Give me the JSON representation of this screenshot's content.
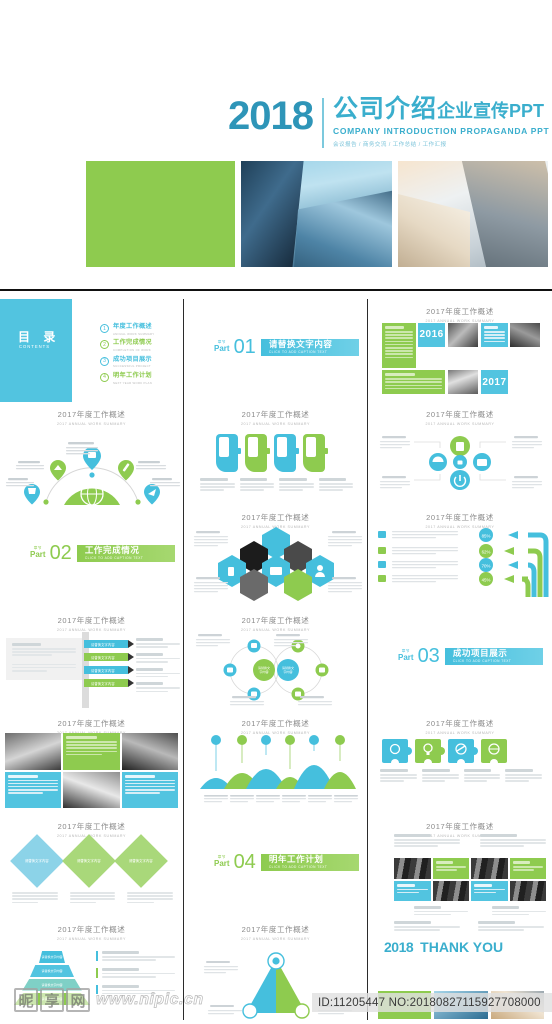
{
  "hero": {
    "year": "2018",
    "title_cn_strong": "公司介绍",
    "title_cn_light": "企业宣传PPT",
    "title_en": "COMPANY  INTRODUCTION   PROPAGANDA  PPT",
    "subtitle": "会议报告 / 商务交流 / 工作总结 / 工作汇报",
    "strip": [
      {
        "name": "green-block",
        "kind": "color",
        "color": "#8ecb4f"
      },
      {
        "name": "glass-towers-photo",
        "kind": "photo"
      },
      {
        "name": "sunlit-towers-photo",
        "kind": "photo"
      }
    ]
  },
  "colors": {
    "blue": "#45bfdd",
    "blue_panel": "#52c4e0",
    "blue_dark": "#2e95b8",
    "green": "#8ecb4f",
    "title_gray": "#8a8a8a"
  },
  "slide_title": {
    "cn": "2017年度工作概述",
    "en": "2017 ANNUAL WORK SUMMARY"
  },
  "contents": {
    "heading_cn": "目 录",
    "heading_en": "CONTENTS",
    "items": [
      {
        "num": "1",
        "cn": "年度工作概述",
        "en": "ANNUAL WORK SUMMARY",
        "color": "blue"
      },
      {
        "num": "2",
        "cn": "工作完成情况",
        "en": "COMPLETION OF WORK",
        "color": "green"
      },
      {
        "num": "3",
        "cn": "成功项目展示",
        "en": "SUCCESSFUL PROJECT",
        "color": "blue"
      },
      {
        "num": "4",
        "cn": "明年工作计划",
        "en": "NEXT YEAR WORK PLAN",
        "color": "green"
      }
    ]
  },
  "sections": [
    {
      "kicker_cn": "章节",
      "kicker_en": "Part",
      "num": "01",
      "cn": "请替换文字内容",
      "en": "CLICK TO ADD CAPTION TEXT",
      "theme": "blue"
    },
    {
      "kicker_cn": "章节",
      "kicker_en": "Part",
      "num": "02",
      "cn": "工作完成情况",
      "en": "CLICK TO ADD CAPTION TEXT",
      "theme": "green"
    },
    {
      "kicker_cn": "章节",
      "kicker_en": "Part",
      "num": "03",
      "cn": "成功项目展示",
      "en": "CLICK TO ADD CAPTION TEXT",
      "theme": "blue"
    },
    {
      "kicker_cn": "章节",
      "kicker_en": "Part",
      "num": "04",
      "cn": "明年工作计划",
      "en": "CLICK TO ADD CAPTION TEXT",
      "theme": "green"
    }
  ],
  "mosaic": {
    "year_left": "2016",
    "year_right": "2017"
  },
  "thank_you": {
    "year": "2018",
    "text": "THANK YOU"
  },
  "watermark": {
    "logo_chars": [
      "昵",
      "享",
      "网"
    ],
    "url": "www.nipic.cn",
    "id_line": "ID:11205447 NO:20180827115927708000"
  },
  "placeholder": {
    "caption_cn": "请替换文字内容",
    "caption_en": "CLICK TO ADD CAPTION TEXT"
  },
  "icons": {
    "arc": [
      "globe-icon",
      "pin-icon",
      "chart-icon",
      "wrench-icon",
      "cup-icon",
      "rocket-icon"
    ],
    "nodeflow": [
      "document-icon",
      "umbrella-icon",
      "lock-icon",
      "camera-icon",
      "power-icon"
    ],
    "hexagon": [
      "phone-icon",
      "laptop-icon",
      "user-icon"
    ],
    "puzzle": [
      "gear-icon",
      "bulb-icon",
      "link-icon",
      "globe-icon"
    ],
    "arrows": [
      "gear-icon",
      "rocket-icon",
      "cloud-icon",
      "heart-icon"
    ]
  },
  "percents": [
    "85%",
    "62%",
    "70%",
    "45%"
  ]
}
